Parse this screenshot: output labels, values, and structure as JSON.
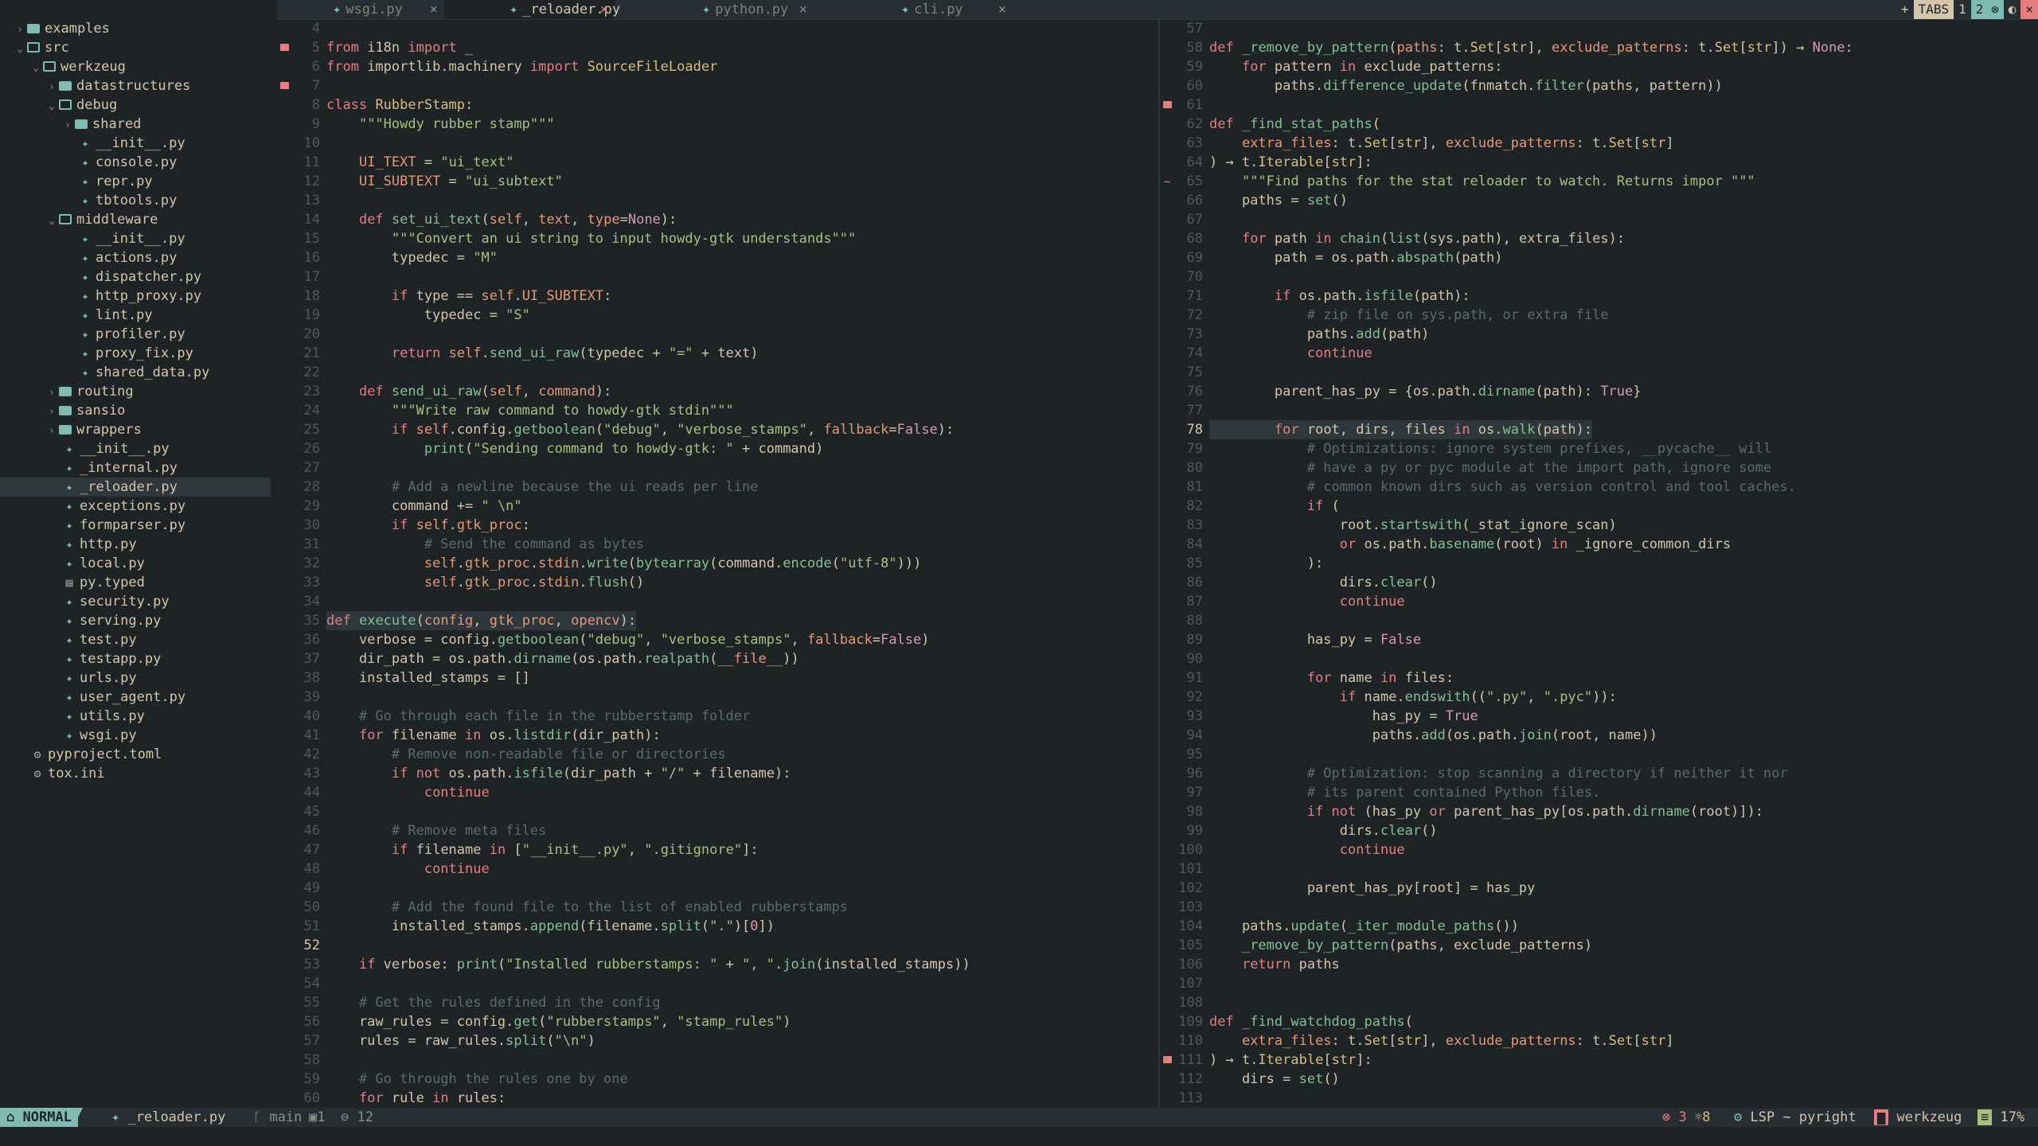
{
  "sidebar": {
    "rows": [
      {
        "label": "examples",
        "type": "folder",
        "depth": 0,
        "open": false
      },
      {
        "label": "src",
        "type": "folder",
        "depth": 0,
        "open": true
      },
      {
        "label": "werkzeug",
        "type": "folder",
        "depth": 1,
        "open": true
      },
      {
        "label": "datastructures",
        "type": "folder",
        "depth": 2,
        "open": false
      },
      {
        "label": "debug",
        "type": "folder",
        "depth": 2,
        "open": true
      },
      {
        "label": "shared",
        "type": "folder",
        "depth": 3,
        "open": false
      },
      {
        "label": "__init__.py",
        "type": "py",
        "depth": 4
      },
      {
        "label": "console.py",
        "type": "py",
        "depth": 4
      },
      {
        "label": "repr.py",
        "type": "py",
        "depth": 4
      },
      {
        "label": "tbtools.py",
        "type": "py",
        "depth": 4
      },
      {
        "label": "middleware",
        "type": "folder",
        "depth": 2,
        "open": true
      },
      {
        "label": "__init__.py",
        "type": "py",
        "depth": 4
      },
      {
        "label": "actions.py",
        "type": "py",
        "depth": 4
      },
      {
        "label": "dispatcher.py",
        "type": "py",
        "depth": 4
      },
      {
        "label": "http_proxy.py",
        "type": "py",
        "depth": 4
      },
      {
        "label": "lint.py",
        "type": "py",
        "depth": 4
      },
      {
        "label": "profiler.py",
        "type": "py",
        "depth": 4
      },
      {
        "label": "proxy_fix.py",
        "type": "py",
        "depth": 4
      },
      {
        "label": "shared_data.py",
        "type": "py",
        "depth": 4
      },
      {
        "label": "routing",
        "type": "folder",
        "depth": 2,
        "open": false
      },
      {
        "label": "sansio",
        "type": "folder",
        "depth": 2,
        "open": false
      },
      {
        "label": "wrappers",
        "type": "folder",
        "depth": 2,
        "open": false
      },
      {
        "label": "__init__.py",
        "type": "py",
        "depth": 3
      },
      {
        "label": "_internal.py",
        "type": "py",
        "depth": 3
      },
      {
        "label": "_reloader.py",
        "type": "py",
        "depth": 3,
        "selected": true
      },
      {
        "label": "exceptions.py",
        "type": "py",
        "depth": 3
      },
      {
        "label": "formparser.py",
        "type": "py",
        "depth": 3
      },
      {
        "label": "http.py",
        "type": "py",
        "depth": 3
      },
      {
        "label": "local.py",
        "type": "py",
        "depth": 3
      },
      {
        "label": "py.typed",
        "type": "txt",
        "depth": 3
      },
      {
        "label": "security.py",
        "type": "py",
        "depth": 3
      },
      {
        "label": "serving.py",
        "type": "py",
        "depth": 3
      },
      {
        "label": "test.py",
        "type": "py",
        "depth": 3
      },
      {
        "label": "testapp.py",
        "type": "py",
        "depth": 3
      },
      {
        "label": "urls.py",
        "type": "py",
        "depth": 3
      },
      {
        "label": "user_agent.py",
        "type": "py",
        "depth": 3
      },
      {
        "label": "utils.py",
        "type": "py",
        "depth": 3
      },
      {
        "label": "wsgi.py",
        "type": "py",
        "depth": 3
      },
      {
        "label": "pyproject.toml",
        "type": "cfg",
        "depth": 1
      },
      {
        "label": "tox.ini",
        "type": "cfg",
        "depth": 1
      }
    ]
  },
  "tabs": [
    {
      "label": "wsgi.py",
      "active": false,
      "close": "×"
    },
    {
      "label": "_reloader.py",
      "active": true,
      "close": "×"
    },
    {
      "label": "python.py",
      "active": false,
      "close": "×"
    },
    {
      "label": "cli.py",
      "active": false,
      "close": "×"
    }
  ],
  "tabs_right": {
    "plus": "+",
    "label": "TABS",
    "one": "1",
    "two": "2",
    "close": "×"
  },
  "left_pane": {
    "current_line": "52",
    "lines": [
      {
        "n": "4",
        "html": ""
      },
      {
        "n": "5",
        "sign": "err",
        "html": "<span class='k'>from</span> i18n <span class='k'>import</span> _"
      },
      {
        "n": "6",
        "html": "<span class='k'>from</span> importlib.machinery <span class='k'>import</span> <span class='cls'>SourceFileLoader</span>"
      },
      {
        "n": "7",
        "sign": "err",
        "html": ""
      },
      {
        "n": "8",
        "html": "<span class='k'>class</span> <span class='cls'>RubberStamp</span>:"
      },
      {
        "n": "9",
        "html": "    <span class='s'>\"\"\"Howdy rubber stamp\"\"\"</span>"
      },
      {
        "n": "10",
        "html": ""
      },
      {
        "n": "11",
        "html": "    <span class='p'>UI_TEXT</span> = <span class='s'>\"ui_text\"</span>"
      },
      {
        "n": "12",
        "html": "    <span class='p'>UI_SUBTEXT</span> = <span class='s'>\"ui_subtext\"</span>"
      },
      {
        "n": "13",
        "html": ""
      },
      {
        "n": "14",
        "html": "    <span class='k'>def</span> <span class='f'>set_ui_text</span>(<span class='self'>self</span>, <span class='self'>text</span>, <span class='self'>type</span>=<span class='num'>None</span>):"
      },
      {
        "n": "15",
        "html": "        <span class='s'>\"\"\"Convert an ui string to input howdy-gtk understands\"\"\"</span>"
      },
      {
        "n": "16",
        "html": "        typedec = <span class='s'>\"M\"</span>"
      },
      {
        "n": "17",
        "html": ""
      },
      {
        "n": "18",
        "html": "        <span class='k'>if</span> type == <span class='self'>self</span>.<span class='p'>UI_SUBTEXT</span>:"
      },
      {
        "n": "19",
        "html": "            typedec = <span class='s'>\"S\"</span>"
      },
      {
        "n": "20",
        "html": ""
      },
      {
        "n": "21",
        "html": "        <span class='k'>return</span> <span class='self'>self</span>.<span class='f'>send_ui_raw</span>(typedec + <span class='s'>\"=\"</span> + text)"
      },
      {
        "n": "22",
        "html": ""
      },
      {
        "n": "23",
        "html": "    <span class='k'>def</span> <span class='f'>send_ui_raw</span>(<span class='self'>self</span>, <span class='self'>command</span>):"
      },
      {
        "n": "24",
        "html": "        <span class='s'>\"\"\"Write raw command to howdy-gtk stdin\"\"\"</span>"
      },
      {
        "n": "25",
        "html": "        <span class='k'>if</span> <span class='self'>self</span>.config.<span class='f'>getboolean</span>(<span class='s'>\"debug\"</span>, <span class='s'>\"verbose_stamps\"</span>, <span class='self'>fallback</span>=<span class='num'>False</span>):"
      },
      {
        "n": "26",
        "html": "            <span class='f'>print</span>(<span class='s'>\"Sending command to howdy-gtk: \"</span> + command)"
      },
      {
        "n": "27",
        "html": ""
      },
      {
        "n": "28",
        "html": "        <span class='c'># Add a newline because the ui reads per line</span>"
      },
      {
        "n": "29",
        "html": "        command += <span class='s'>\" \\n\"</span>"
      },
      {
        "n": "30",
        "html": "        <span class='k'>if</span> <span class='self'>self</span>.<span class='p'>gtk_proc</span>:"
      },
      {
        "n": "31",
        "html": "            <span class='c'># Send the command as bytes</span>"
      },
      {
        "n": "32",
        "html": "            <span class='self'>self</span>.<span class='p'>gtk_proc</span>.<span class='p'>stdin</span>.<span class='f'>write</span>(<span class='f'>bytearray</span>(command.<span class='f'>encode</span>(<span class='s'>\"utf-8\"</span>)))"
      },
      {
        "n": "33",
        "html": "            <span class='self'>self</span>.<span class='p'>gtk_proc</span>.<span class='p'>stdin</span>.<span class='f'>flush</span>()"
      },
      {
        "n": "34",
        "html": ""
      },
      {
        "n": "35",
        "hl": true,
        "html": "<span class='k'>def</span> <span class='f'>execute</span>(<span class='self'>config</span>, <span class='self'>gtk_proc</span>, <span class='self'>opencv</span>):"
      },
      {
        "n": "36",
        "html": "    verbose = config.<span class='f'>getboolean</span>(<span class='s'>\"debug\"</span>, <span class='s'>\"verbose_stamps\"</span>, <span class='self'>fallback</span>=<span class='num'>False</span>)"
      },
      {
        "n": "37",
        "html": "    dir_path = os.path.<span class='f'>dirname</span>(os.path.<span class='f'>realpath</span>(<span class='p'>__file__</span>))"
      },
      {
        "n": "38",
        "html": "    installed_stamps = []"
      },
      {
        "n": "39",
        "html": ""
      },
      {
        "n": "40",
        "html": "    <span class='c'># Go through each file in the rubberstamp folder</span>"
      },
      {
        "n": "41",
        "html": "    <span class='k'>for</span> filename <span class='k'>in</span> os.<span class='f'>listdir</span>(dir_path):"
      },
      {
        "n": "42",
        "html": "        <span class='c'># Remove non-readable file or directories</span>"
      },
      {
        "n": "43",
        "html": "        <span class='k'>if not</span> os.path.<span class='f'>isfile</span>(dir_path + <span class='s'>\"/\"</span> + filename):"
      },
      {
        "n": "44",
        "html": "            <span class='k'>continue</span>"
      },
      {
        "n": "45",
        "html": ""
      },
      {
        "n": "46",
        "html": "        <span class='c'># Remove meta files</span>"
      },
      {
        "n": "47",
        "html": "        <span class='k'>if</span> filename <span class='k'>in</span> [<span class='s'>\"__init__.py\"</span>, <span class='s'>\".gitignore\"</span>]:"
      },
      {
        "n": "48",
        "html": "            <span class='k'>continue</span>"
      },
      {
        "n": "49",
        "html": ""
      },
      {
        "n": "50",
        "html": "        <span class='c'># Add the found file to the list of enabled rubberstamps</span>"
      },
      {
        "n": "51",
        "html": "        installed_stamps.<span class='f'>append</span>(filename.<span class='f'>split</span>(<span class='s'>\".\"</span>)[<span class='num'>0</span>])"
      },
      {
        "n": "52",
        "cur": true,
        "html": ""
      },
      {
        "n": "53",
        "html": "    <span class='k'>if</span> verbose: <span class='f'>print</span>(<span class='s'>\"Installed rubberstamps: \"</span> + <span class='s'>\", \"</span>.<span class='f'>join</span>(installed_stamps))"
      },
      {
        "n": "54",
        "html": ""
      },
      {
        "n": "55",
        "html": "    <span class='c'># Get the rules defined in the config</span>"
      },
      {
        "n": "56",
        "html": "    raw_rules = config.<span class='f'>get</span>(<span class='s'>\"rubberstamps\"</span>, <span class='s'>\"stamp_rules\"</span>)"
      },
      {
        "n": "57",
        "html": "    rules = raw_rules.<span class='f'>split</span>(<span class='s'>\"\\n\"</span>)"
      },
      {
        "n": "58",
        "html": ""
      },
      {
        "n": "59",
        "html": "    <span class='c'># Go through the rules one by one</span>"
      },
      {
        "n": "60",
        "html": "    <span class='k'>for</span> rule <span class='k'>in</span> rules:"
      }
    ]
  },
  "right_pane": {
    "current_line": "78",
    "lines": [
      {
        "n": "57",
        "html": ""
      },
      {
        "n": "58",
        "html": "<span class='k'>def</span> <span class='f'>_remove_by_pattern</span>(<span class='self'>paths</span>: t.<span class='cls'>Set</span>[<span class='cls'>str</span>], <span class='self'>exclude_patterns</span>: t.<span class='cls'>Set</span>[<span class='cls'>str</span>]) → <span class='num'>None</span>:"
      },
      {
        "n": "59",
        "html": "    <span class='k'>for</span> pattern <span class='k'>in</span> exclude_patterns:"
      },
      {
        "n": "60",
        "html": "        paths.<span class='f'>difference_update</span>(fnmatch.<span class='f'>filter</span>(paths, pattern))"
      },
      {
        "n": "61",
        "sign": "err",
        "html": ""
      },
      {
        "n": "62",
        "html": "<span class='k'>def</span> <span class='f'>_find_stat_paths</span>("
      },
      {
        "n": "63",
        "html": "    <span class='self'>extra_files</span>: t.<span class='cls'>Set</span>[<span class='cls'>str</span>], <span class='self'>exclude_patterns</span>: t.<span class='cls'>Set</span>[<span class='cls'>str</span>]"
      },
      {
        "n": "64",
        "html": ") → t.<span class='cls'>Iterable</span>[<span class='cls'>str</span>]:"
      },
      {
        "n": "65",
        "sign": "warn",
        "html": "    <span class='s'>\"\"\"Find paths for the stat reloader to watch. Returns impor \"\"\"</span>"
      },
      {
        "n": "66",
        "html": "    paths = <span class='f'>set</span>()"
      },
      {
        "n": "67",
        "html": ""
      },
      {
        "n": "68",
        "html": "    <span class='k'>for</span> path <span class='k'>in</span> <span class='f'>chain</span>(<span class='f'>list</span>(sys.path), extra_files):"
      },
      {
        "n": "69",
        "html": "        path = os.path.<span class='f'>abspath</span>(path)"
      },
      {
        "n": "70",
        "html": ""
      },
      {
        "n": "71",
        "html": "        <span class='k'>if</span> os.path.<span class='f'>isfile</span>(path):"
      },
      {
        "n": "72",
        "html": "            <span class='c'># zip file on sys.path, or extra file</span>"
      },
      {
        "n": "73",
        "html": "            paths.<span class='f'>add</span>(path)"
      },
      {
        "n": "74",
        "html": "            <span class='k'>continue</span>"
      },
      {
        "n": "75",
        "html": ""
      },
      {
        "n": "76",
        "html": "        parent_has_py = {os.path.<span class='f'>dirname</span>(path): <span class='num'>True</span>}"
      },
      {
        "n": "77",
        "html": ""
      },
      {
        "n": "78",
        "cur": true,
        "hl": true,
        "html": "        <span class='k'>for</span> root, dirs, files <span class='k'>in</span> os.<span class='f'>walk</span>(path):"
      },
      {
        "n": "79",
        "html": "            <span class='c'># Optimizations: ignore system prefixes, __pycache__ will</span>"
      },
      {
        "n": "80",
        "html": "            <span class='c'># have a py or pyc module at the import path, ignore some</span>"
      },
      {
        "n": "81",
        "html": "            <span class='c'># common known dirs such as version control and tool caches.</span>"
      },
      {
        "n": "82",
        "html": "            <span class='k'>if</span> ("
      },
      {
        "n": "83",
        "html": "                root.<span class='f'>startswith</span>(_stat_ignore_scan)"
      },
      {
        "n": "84",
        "html": "                <span class='k'>or</span> os.path.<span class='f'>basename</span>(root) <span class='k'>in</span> _ignore_common_dirs"
      },
      {
        "n": "85",
        "html": "            ):"
      },
      {
        "n": "86",
        "html": "                dirs.<span class='f'>clear</span>()"
      },
      {
        "n": "87",
        "html": "                <span class='k'>continue</span>"
      },
      {
        "n": "88",
        "html": ""
      },
      {
        "n": "89",
        "html": "            has_py = <span class='num'>False</span>"
      },
      {
        "n": "90",
        "html": ""
      },
      {
        "n": "91",
        "html": "            <span class='k'>for</span> name <span class='k'>in</span> files:"
      },
      {
        "n": "92",
        "html": "                <span class='k'>if</span> name.<span class='f'>endswith</span>((<span class='s'>\".py\"</span>, <span class='s'>\".pyc\"</span>)):"
      },
      {
        "n": "93",
        "html": "                    has_py = <span class='num'>True</span>"
      },
      {
        "n": "94",
        "html": "                    paths.<span class='f'>add</span>(os.path.<span class='f'>join</span>(root, name))"
      },
      {
        "n": "95",
        "html": ""
      },
      {
        "n": "96",
        "html": "            <span class='c'># Optimization: stop scanning a directory if neither it nor</span>"
      },
      {
        "n": "97",
        "html": "            <span class='c'># its parent contained Python files.</span>"
      },
      {
        "n": "98",
        "html": "            <span class='k'>if not</span> (has_py <span class='k'>or</span> parent_has_py[os.path.<span class='f'>dirname</span>(root)]):"
      },
      {
        "n": "99",
        "html": "                dirs.<span class='f'>clear</span>()"
      },
      {
        "n": "100",
        "html": "                <span class='k'>continue</span>"
      },
      {
        "n": "101",
        "html": ""
      },
      {
        "n": "102",
        "html": "            parent_has_py[root] = has_py"
      },
      {
        "n": "103",
        "html": ""
      },
      {
        "n": "104",
        "html": "    paths.<span class='f'>update</span>(<span class='f'>_iter_module_paths</span>())"
      },
      {
        "n": "105",
        "html": "    <span class='f'>_remove_by_pattern</span>(paths, exclude_patterns)"
      },
      {
        "n": "106",
        "html": "    <span class='k'>return</span> paths"
      },
      {
        "n": "107",
        "html": ""
      },
      {
        "n": "108",
        "html": ""
      },
      {
        "n": "109",
        "html": "<span class='k'>def</span> <span class='f'>_find_watchdog_paths</span>("
      },
      {
        "n": "110",
        "html": "    <span class='self'>extra_files</span>: t.<span class='cls'>Set</span>[<span class='cls'>str</span>], <span class='self'>exclude_patterns</span>: t.<span class='cls'>Set</span>[<span class='cls'>str</span>]"
      },
      {
        "n": "111",
        "sign": "err",
        "html": ") → t.<span class='cls'>Iterable</span>[<span class='cls'>str</span>]:"
      },
      {
        "n": "112",
        "html": "    dirs = <span class='f'>set</span>()"
      },
      {
        "n": "113",
        "html": ""
      }
    ]
  },
  "statusline": {
    "mode": "NORMAL",
    "file": "_reloader.py",
    "branch": "main",
    "diag1": "1",
    "diag2": "12",
    "errors": "3",
    "warnings": "8",
    "lsp": "LSP ~ pyright",
    "project": "werkzeug",
    "percent": "17%"
  },
  "colors": {
    "bg": "#1e2326",
    "accent": "#7fbbb3",
    "error": "#e67e80",
    "string": "#a7c080"
  }
}
